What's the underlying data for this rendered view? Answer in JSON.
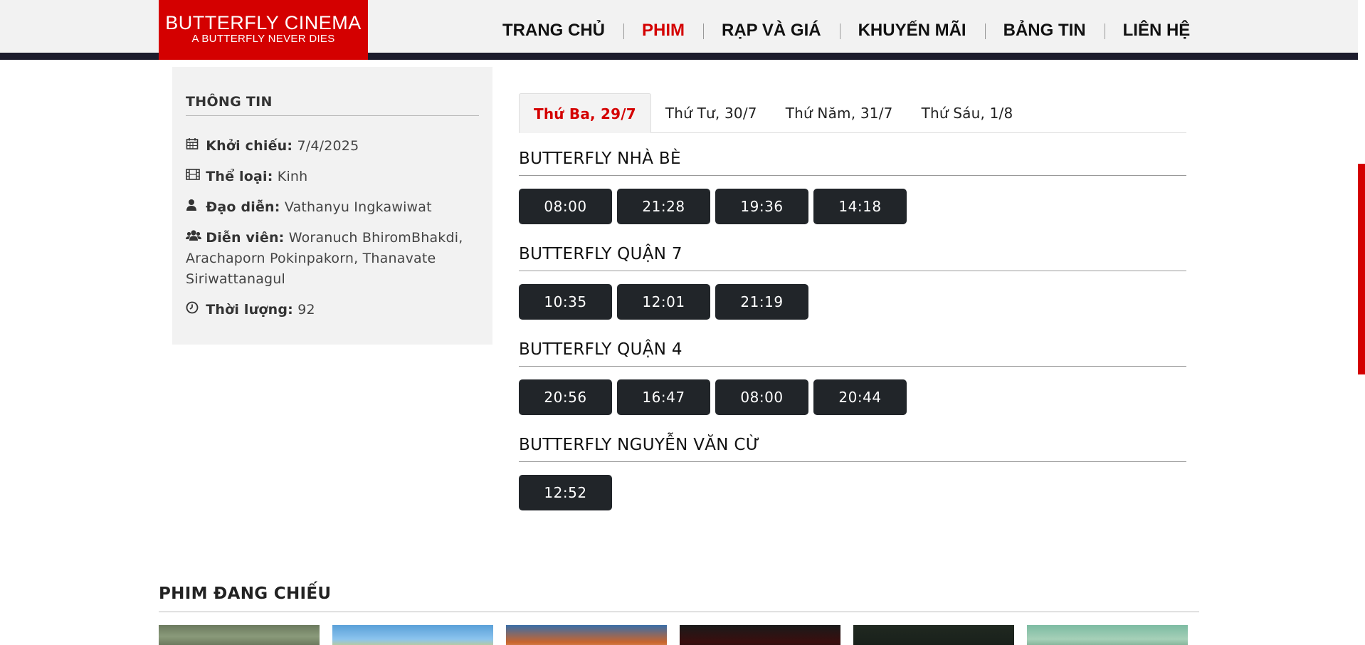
{
  "header": {
    "logo_name": "BUTTERFLY CINEMA",
    "logo_tagline": "A BUTTERFLY NEVER DIES",
    "nav": [
      "TRANG CHỦ",
      "PHIM",
      "RẠP VÀ GIÁ",
      "KHUYẾN MÃI",
      "BẢNG TIN",
      "LIÊN HỆ"
    ],
    "active_nav": "PHIM"
  },
  "info": {
    "title": "THÔNG TIN",
    "release_label": "Khởi chiếu:",
    "release_value": "7/4/2025",
    "genre_label": "Thể loại:",
    "genre_value": "Kinh",
    "director_label": "Đạo diễn:",
    "director_value": "Vathanyu Ingkawiwat",
    "cast_label": "Diễn viên:",
    "cast_value": "Woranuch BhiromBhakdi, Arachaporn Pokinpakorn, Thanavate Siriwattanagul",
    "duration_label": "Thời lượng:",
    "duration_value": "92"
  },
  "tabs": [
    "Thứ Ba, 29/7",
    "Thứ Tư, 30/7",
    "Thứ Năm, 31/7",
    "Thứ Sáu, 1/8"
  ],
  "cinemas": [
    {
      "name": "BUTTERFLY NHÀ BÈ",
      "times": [
        "08:00",
        "21:28",
        "19:36",
        "14:18"
      ]
    },
    {
      "name": "BUTTERFLY QUẬN 7",
      "times": [
        "10:35",
        "12:01",
        "21:19"
      ]
    },
    {
      "name": "BUTTERFLY QUẬN 4",
      "times": [
        "20:56",
        "16:47",
        "08:00",
        "20:44"
      ]
    },
    {
      "name": "BUTTERFLY NGUYỄN VĂN CỪ",
      "times": [
        "12:52"
      ]
    }
  ],
  "now_showing_title": "PHIM ĐANG CHIẾU",
  "colors": {
    "brand_red": "#d40000",
    "dark_button": "#212529",
    "panel_gray": "#f2f2f2"
  },
  "icons": {
    "release": "calendar-icon",
    "genre": "film-icon",
    "director": "user-icon",
    "cast": "users-icon",
    "duration": "clock-icon"
  }
}
